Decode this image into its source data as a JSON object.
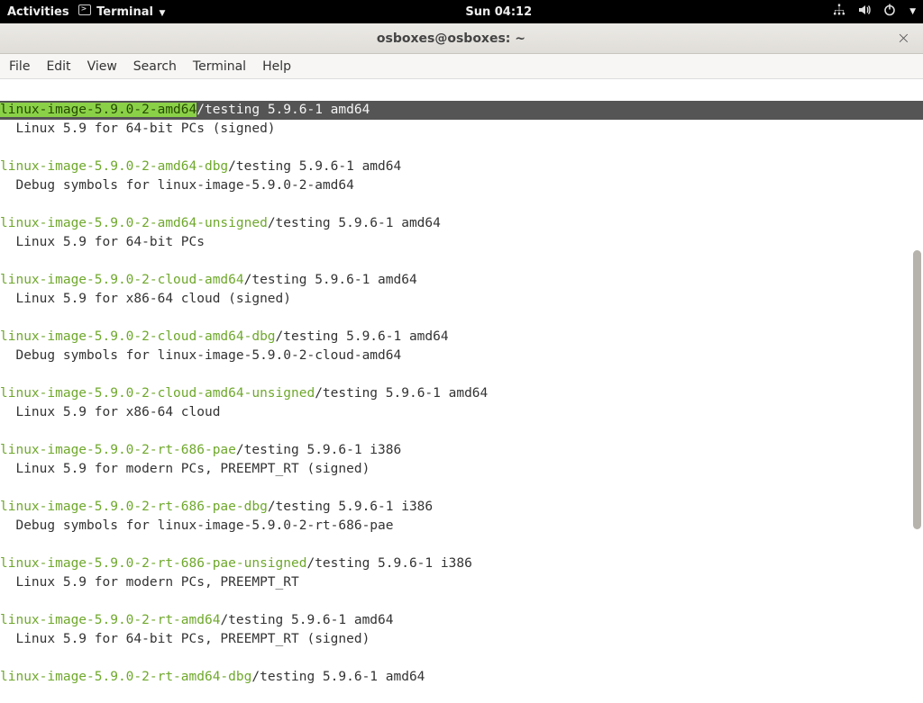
{
  "topbar": {
    "activities": "Activities",
    "app_label": "Terminal",
    "clock": "Sun 04:12"
  },
  "window": {
    "title": "osboxes@osboxes: ~"
  },
  "menubar": {
    "items": [
      "File",
      "Edit",
      "View",
      "Search",
      "Terminal",
      "Help"
    ]
  },
  "packages": [
    {
      "name": "linux-image-5.9.0-2-amd64",
      "suffix": "/testing 5.9.6-1 amd64",
      "desc": "  Linux 5.9 for 64-bit PCs (signed)",
      "highlighted": true
    },
    {
      "name": "linux-image-5.9.0-2-amd64-dbg",
      "suffix": "/testing 5.9.6-1 amd64",
      "desc": "  Debug symbols for linux-image-5.9.0-2-amd64"
    },
    {
      "name": "linux-image-5.9.0-2-amd64-unsigned",
      "suffix": "/testing 5.9.6-1 amd64",
      "desc": "  Linux 5.9 for 64-bit PCs"
    },
    {
      "name": "linux-image-5.9.0-2-cloud-amd64",
      "suffix": "/testing 5.9.6-1 amd64",
      "desc": "  Linux 5.9 for x86-64 cloud (signed)"
    },
    {
      "name": "linux-image-5.9.0-2-cloud-amd64-dbg",
      "suffix": "/testing 5.9.6-1 amd64",
      "desc": "  Debug symbols for linux-image-5.9.0-2-cloud-amd64"
    },
    {
      "name": "linux-image-5.9.0-2-cloud-amd64-unsigned",
      "suffix": "/testing 5.9.6-1 amd64",
      "desc": "  Linux 5.9 for x86-64 cloud"
    },
    {
      "name": "linux-image-5.9.0-2-rt-686-pae",
      "suffix": "/testing 5.9.6-1 i386",
      "desc": "  Linux 5.9 for modern PCs, PREEMPT_RT (signed)"
    },
    {
      "name": "linux-image-5.9.0-2-rt-686-pae-dbg",
      "suffix": "/testing 5.9.6-1 i386",
      "desc": "  Debug symbols for linux-image-5.9.0-2-rt-686-pae"
    },
    {
      "name": "linux-image-5.9.0-2-rt-686-pae-unsigned",
      "suffix": "/testing 5.9.6-1 i386",
      "desc": "  Linux 5.9 for modern PCs, PREEMPT_RT"
    },
    {
      "name": "linux-image-5.9.0-2-rt-amd64",
      "suffix": "/testing 5.9.6-1 amd64",
      "desc": "  Linux 5.9 for 64-bit PCs, PREEMPT_RT (signed)"
    },
    {
      "name": "linux-image-5.9.0-2-rt-amd64-dbg",
      "suffix": "/testing 5.9.6-1 amd64",
      "desc": ""
    }
  ]
}
